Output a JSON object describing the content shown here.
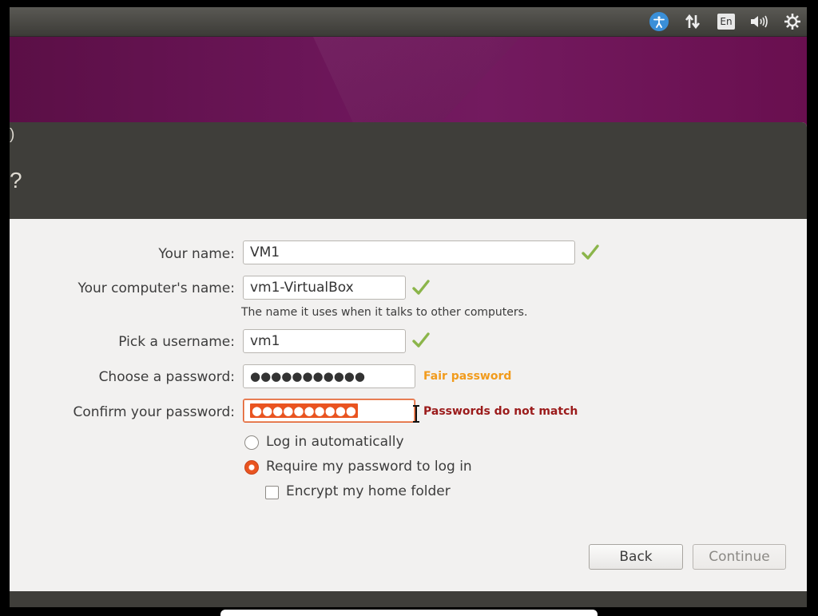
{
  "top_panel": {
    "keyboard_layout": "En",
    "icons": [
      "accessibility-icon",
      "network-icon",
      "keyboard-layout-icon",
      "volume-icon",
      "power-gear-icon"
    ]
  },
  "window": {
    "title_fragment": ")",
    "header_fragment": "?"
  },
  "form": {
    "your_name": {
      "label": "Your name:",
      "value": "VM1"
    },
    "computer_name": {
      "label": "Your computer's name:",
      "value": "vm1-VirtualBox",
      "hint": "The name it uses when it talks to other computers."
    },
    "username": {
      "label": "Pick a username:",
      "value": "vm1"
    },
    "password": {
      "label": "Choose a password:",
      "value": "●●●●●●●●●●●",
      "strength": "Fair password"
    },
    "confirm": {
      "label": "Confirm your password:",
      "value": "●●●●●●●●●●",
      "error": "Passwords do not match"
    }
  },
  "options": {
    "login_auto": "Log in automatically",
    "require_password": "Require my password to log in",
    "encrypt_home": "Encrypt my home folder",
    "selected": "require_password",
    "encrypt_checked": false
  },
  "buttons": {
    "back": "Back",
    "continue": "Continue"
  },
  "colors": {
    "check_green": "#8bb54a",
    "fair_orange": "#f19b1c",
    "error_red": "#9b1b1b",
    "accent": "#e95420"
  }
}
